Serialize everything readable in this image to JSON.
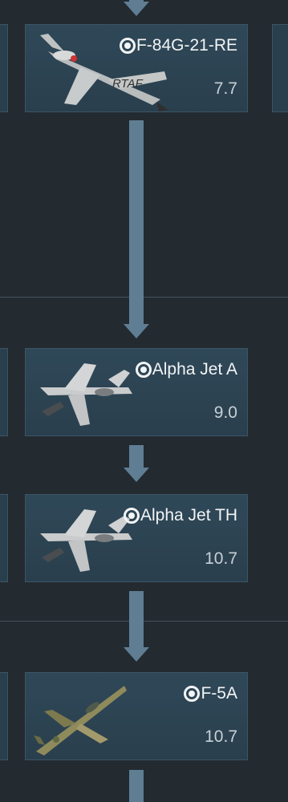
{
  "vehicles": [
    {
      "name": "F-84G-21-RE",
      "br": "7.7",
      "aircraft_icon": "f84-aircraft-icon",
      "status_icon": "researched-marker-icon"
    },
    {
      "name": "Alpha Jet A",
      "br": "9.0",
      "aircraft_icon": "alpha-jet-aircraft-icon",
      "status_icon": "researched-marker-icon"
    },
    {
      "name": "Alpha Jet TH",
      "br": "10.7",
      "aircraft_icon": "alpha-jet-aircraft-icon",
      "status_icon": "researched-marker-icon"
    },
    {
      "name": "F-5A",
      "br": "10.7",
      "aircraft_icon": "f5a-aircraft-icon",
      "status_icon": "researched-marker-icon"
    }
  ],
  "colors": {
    "background": "#232a30",
    "card": "#2f4858",
    "arrow": "#5f7e93",
    "text": "#f2f4f5"
  }
}
